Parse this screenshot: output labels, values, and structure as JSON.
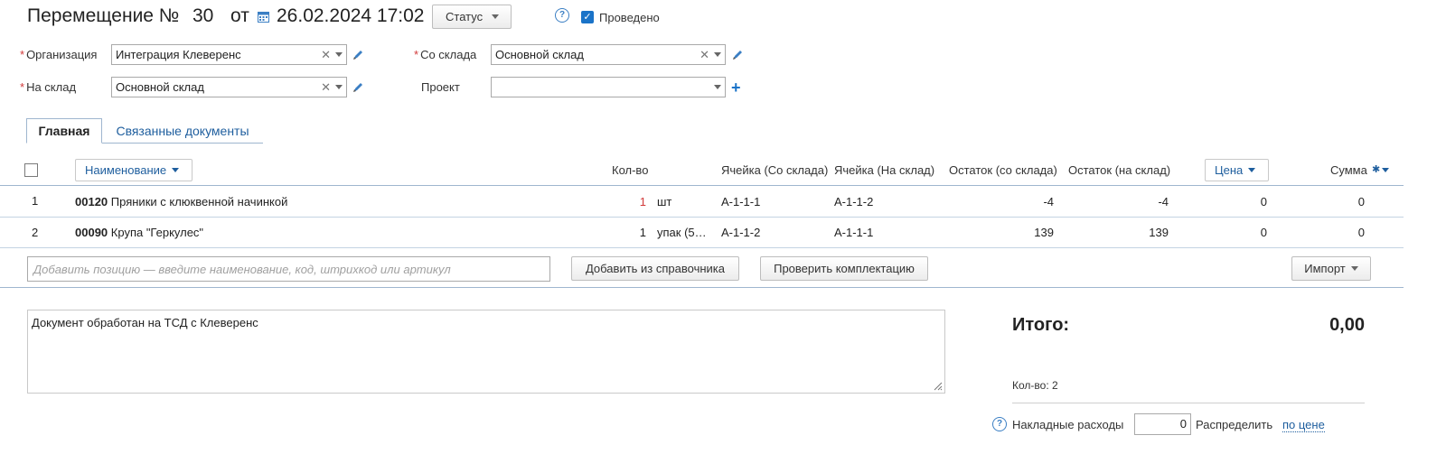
{
  "header": {
    "title": "Перемещение №",
    "number": "30",
    "from_label": "от",
    "date": "26.02.2024 17:02",
    "status_label": "Статус",
    "posted_label": "Проведено"
  },
  "form": {
    "organization_label": "Организация",
    "organization_value": "Интеграция Клеверенс",
    "from_store_label": "Со склада",
    "from_store_value": "Основной склад",
    "to_store_label": "На склад",
    "to_store_value": "Основной склад",
    "project_label": "Проект",
    "project_value": ""
  },
  "tabs": [
    {
      "label": "Главная",
      "active": true
    },
    {
      "label": "Связанные документы",
      "active": false
    }
  ],
  "table": {
    "columns": {
      "name": "Наименование",
      "qty": "Кол-во",
      "cell_from": "Ячейка (Со склада)",
      "cell_to": "Ячейка (На склад)",
      "rest_from": "Остаток (со склада)",
      "rest_to": "Остаток (на склад)",
      "price": "Цена",
      "sum": "Сумма"
    },
    "rows": [
      {
        "n": "1",
        "code": "00120",
        "name": "Пряники с клюквенной начинкой",
        "qty": "1",
        "unit": "шт",
        "cell_from": "А-1-1-1",
        "cell_to": "А-1-1-2",
        "rest_from": "-4",
        "rest_to": "-4",
        "price": "0",
        "sum": "0"
      },
      {
        "n": "2",
        "code": "00090",
        "name": "Крупа \"Геркулес\"",
        "qty": "1",
        "unit": "упак (5…",
        "cell_from": "А-1-1-2",
        "cell_to": "А-1-1-1",
        "rest_from": "139",
        "rest_to": "139",
        "price": "0",
        "sum": "0"
      }
    ]
  },
  "actions": {
    "add_placeholder": "Добавить позицию — введите наименование, код, штрихкод или артикул",
    "add_from_catalog": "Добавить из справочника",
    "check_completeness": "Проверить комплектацию",
    "import": "Импорт"
  },
  "comment": "Документ обработан на ТСД с Клеверенс",
  "summary": {
    "total_label": "Итого:",
    "total_value": "0,00",
    "count_label": "Кол-во: 2",
    "overhead_label": "Накладные расходы",
    "overhead_value": "0",
    "distribute_label": "Распределить",
    "distribute_link": "по цене"
  },
  "colors": {
    "accent": "#1a73c8",
    "link": "#1e5e9e",
    "required": "#d23a3a"
  }
}
